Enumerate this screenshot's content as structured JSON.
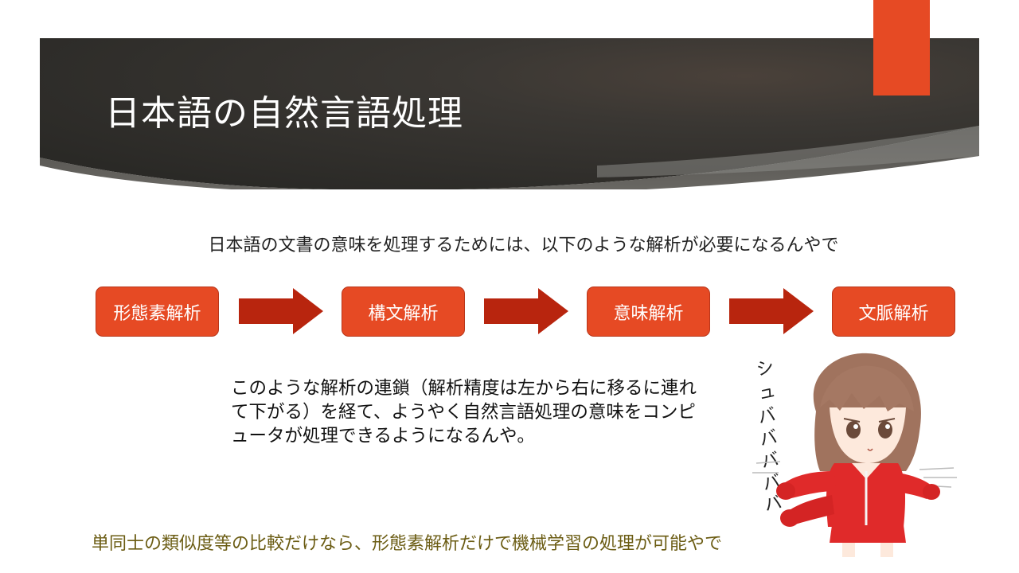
{
  "slide": {
    "title": "日本語の自然言語処理",
    "intro": "日本語の文書の意味を処理するためには、以下のような解析が必要になるんやで",
    "steps": [
      {
        "label": "形態素解析"
      },
      {
        "label": "構文解析"
      },
      {
        "label": "意味解析"
      },
      {
        "label": "文脈解析"
      }
    ],
    "body": "このような解析の連鎖（解析精度は左から右に移るに連れて下がる）を経て、ようやく自然言語処理の意味をコンピュータが処理できるようになるんや。",
    "footer": "単同士の類似度等の比較だけなら、形態素解析だけで機械学習の処理が可能やで",
    "illustration_sfx": "シュバババババ"
  },
  "colors": {
    "accent": "#e64a24",
    "banner_dark": "#2f2d29",
    "footer_text": "#6b5c13"
  }
}
